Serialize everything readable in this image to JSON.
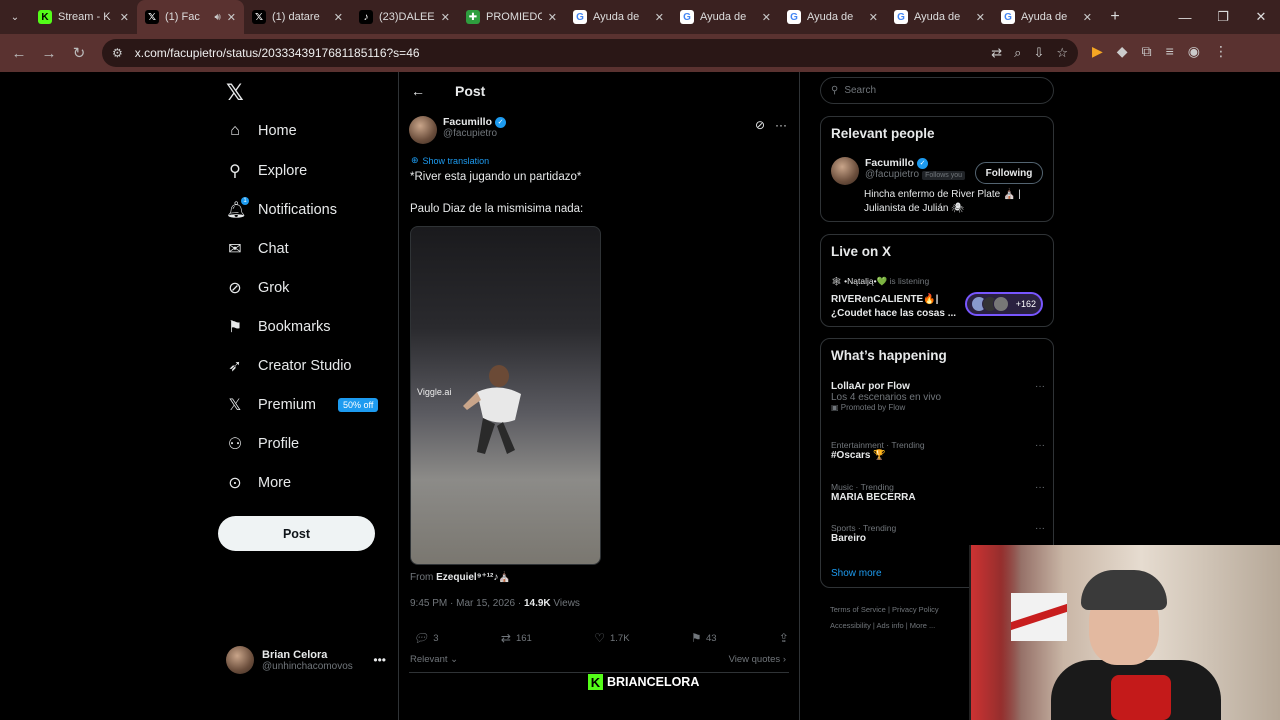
{
  "browser": {
    "tabs": [
      {
        "label": "Stream - K",
        "fav": "K",
        "favbg": "#53fc18",
        "favcolor": "#000"
      },
      {
        "label": "(1) Fac",
        "fav": "𝕏",
        "favbg": "#000",
        "favcolor": "#fff",
        "active": true
      },
      {
        "label": "(1) datare",
        "fav": "𝕏",
        "favbg": "#000",
        "favcolor": "#fff"
      },
      {
        "label": "(23)DALEE",
        "fav": "♪",
        "favbg": "#000",
        "favcolor": "#fff"
      },
      {
        "label": "PROMIEDO",
        "fav": "✚",
        "favbg": "#2e9e3e",
        "favcolor": "#fff"
      },
      {
        "label": "Ayuda de",
        "fav": "G",
        "favbg": "#fff",
        "favcolor": "#4285f4"
      },
      {
        "label": "Ayuda de",
        "fav": "G",
        "favbg": "#fff",
        "favcolor": "#4285f4"
      },
      {
        "label": "Ayuda de",
        "fav": "G",
        "favbg": "#fff",
        "favcolor": "#4285f4"
      },
      {
        "label": "Ayuda de",
        "fav": "G",
        "favbg": "#fff",
        "favcolor": "#4285f4"
      },
      {
        "label": "Ayuda de",
        "fav": "G",
        "favbg": "#fff",
        "favcolor": "#4285f4"
      }
    ],
    "url": "x.com/facupietro/status/2033343917681185116?s=46"
  },
  "nav": {
    "items": [
      "Home",
      "Explore",
      "Notifications",
      "Chat",
      "Grok",
      "Bookmarks",
      "Creator Studio",
      "Premium",
      "Profile",
      "More"
    ],
    "premium_badge": "50% off",
    "notif_count": "1",
    "post_button": "Post",
    "account": {
      "name": "Brian Celora",
      "handle": "@unhinchacomovos"
    }
  },
  "post": {
    "header": "Post",
    "author_name": "Facumillo",
    "author_handle": "@facupietro",
    "show_translation": "Show translation",
    "line1": "*River esta jugando un partidazo*",
    "line2": "Paulo Diaz de la mismisima nada:",
    "media_watermark": "Viggle.ai",
    "from_label": "From",
    "from_user": "Ezequiel⁹⁺¹²♪⛪",
    "time": "9:45 PM · Mar 15, 2026 · ",
    "views_count": "14.9K",
    "views_label": " Views",
    "replies": "3",
    "reposts": "161",
    "likes": "1.7K",
    "bookmarks": "43",
    "relevant": "Relevant",
    "view_quotes": "View quotes"
  },
  "sidebar": {
    "search_placeholder": "Search",
    "relevant_people": {
      "title": "Relevant people",
      "name": "Facumillo",
      "handle": "@facupietro",
      "follows_you": "Follows you",
      "button": "Following",
      "bio": "Hincha enfermo de River Plate ⛪ | Julianista de Julián 🕷"
    },
    "live": {
      "title": "Live on X",
      "listener": "🕸 •Nątalją•💚",
      "listening": " is listening",
      "space_title": "RIVERenCALIENTE🔥| ¿Coudet hace las cosas ...",
      "count": "+162"
    },
    "whats_happening": {
      "title": "What’s happening",
      "trends": [
        {
          "category": "",
          "name": "LollaAr por Flow",
          "sub": "Los 4 escenarios en vivo",
          "promo": "Promoted by Flow"
        },
        {
          "category": "Entertainment · Trending",
          "name": "#Oscars 🏆",
          "sub": "",
          "promo": ""
        },
        {
          "category": "Music · Trending",
          "name": "MARIA BECERRA",
          "sub": "",
          "promo": ""
        },
        {
          "category": "Sports · Trending",
          "name": "Bareiro",
          "sub": "",
          "promo": ""
        }
      ],
      "show_more": "Show more"
    },
    "footer": [
      "Terms of Service",
      "Privacy Policy",
      "Accessibility",
      "Ads info",
      "More ..."
    ]
  },
  "stream": {
    "brand": "BRIANCELORA"
  }
}
